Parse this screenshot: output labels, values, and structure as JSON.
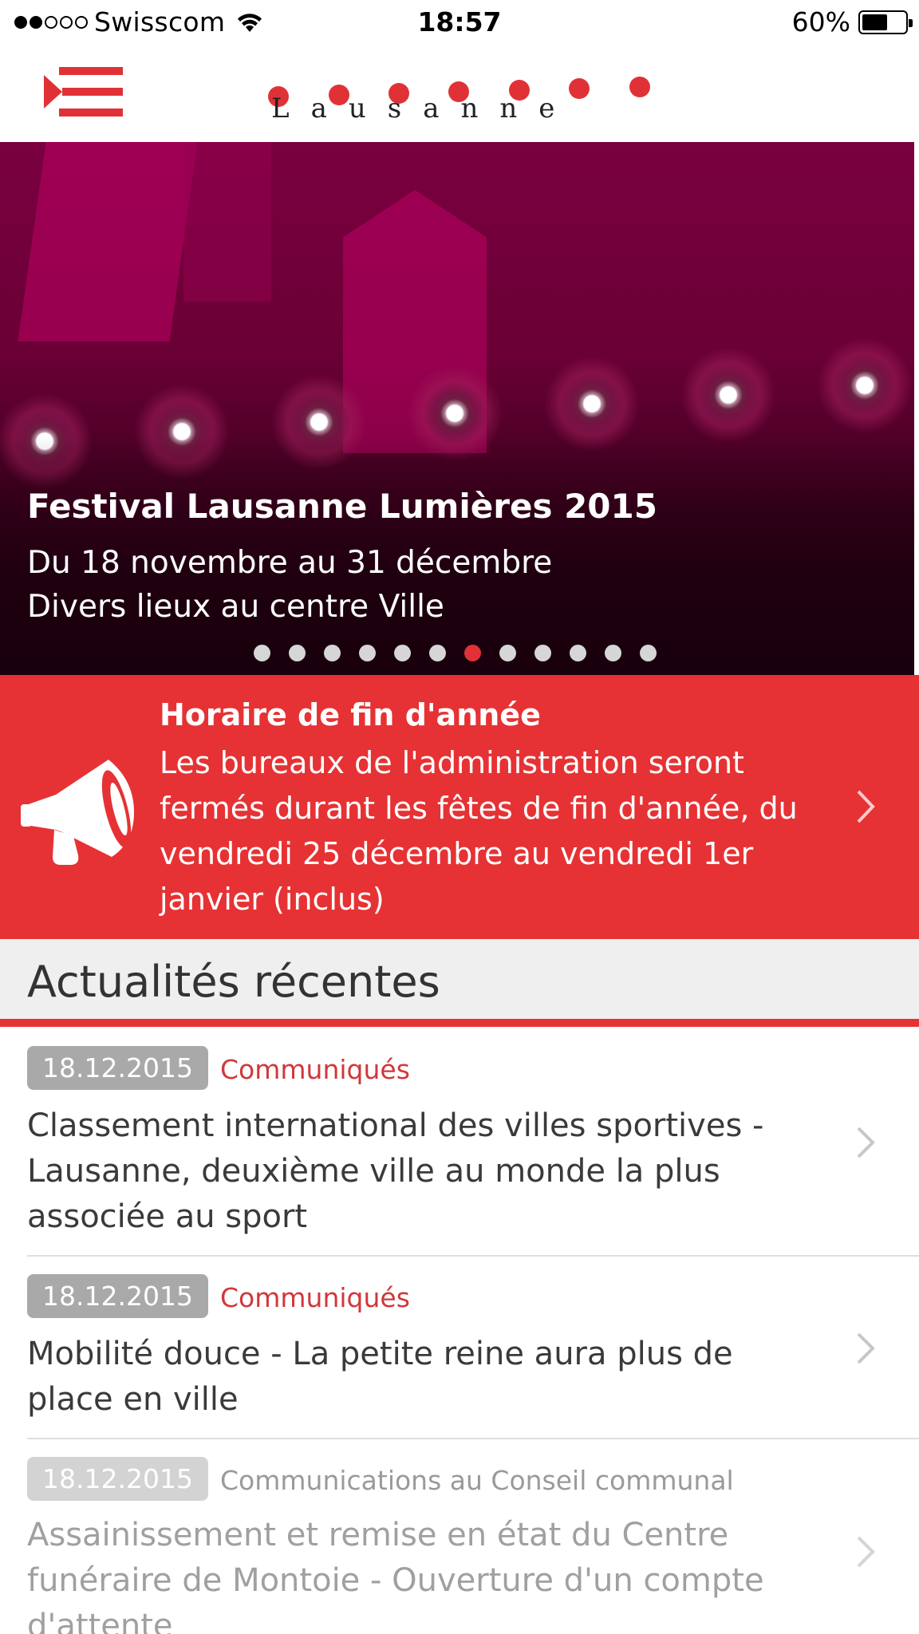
{
  "status_bar": {
    "carrier": "Swisscom",
    "time": "18:57",
    "battery_percent": "60%",
    "battery_level": 0.6,
    "signal_bars_filled": 2,
    "signal_bars_total": 5
  },
  "header": {
    "logo_text": "Lausanne",
    "menu_icon": "menu-icon"
  },
  "hero": {
    "title": "Festival Lausanne Lumières 2015",
    "line1": "Du 18 novembre au 31 décembre",
    "line2": "Divers lieux au centre Ville",
    "slide_count": 12,
    "active_slide": 7
  },
  "announcement": {
    "icon": "megaphone-icon",
    "title": "Horaire de fin d'année",
    "body": "Les bureaux de l'administration seront fermés durant les fêtes de fin d'année, du vendredi 25 décembre au vendredi 1er janvier (inclus)"
  },
  "section": {
    "title": "Actualités récentes"
  },
  "news": [
    {
      "date": "18.12.2015",
      "category": "Communiqués",
      "title": "Classement international des villes sportives - Lausanne, deuxième ville au monde la plus associée au sport"
    },
    {
      "date": "18.12.2015",
      "category": "Communiqués",
      "title": "Mobilité douce - La petite reine aura plus de place en ville"
    },
    {
      "date": "18.12.2015",
      "category": "Communications au Conseil communal",
      "title": "Assainissement et remise en état du Centre funéraire de Montoie - Ouverture d'un compte d'attente"
    }
  ],
  "colors": {
    "brand_red": "#e63234",
    "active_dot": "#e03236",
    "category_red": "#d2373b"
  }
}
